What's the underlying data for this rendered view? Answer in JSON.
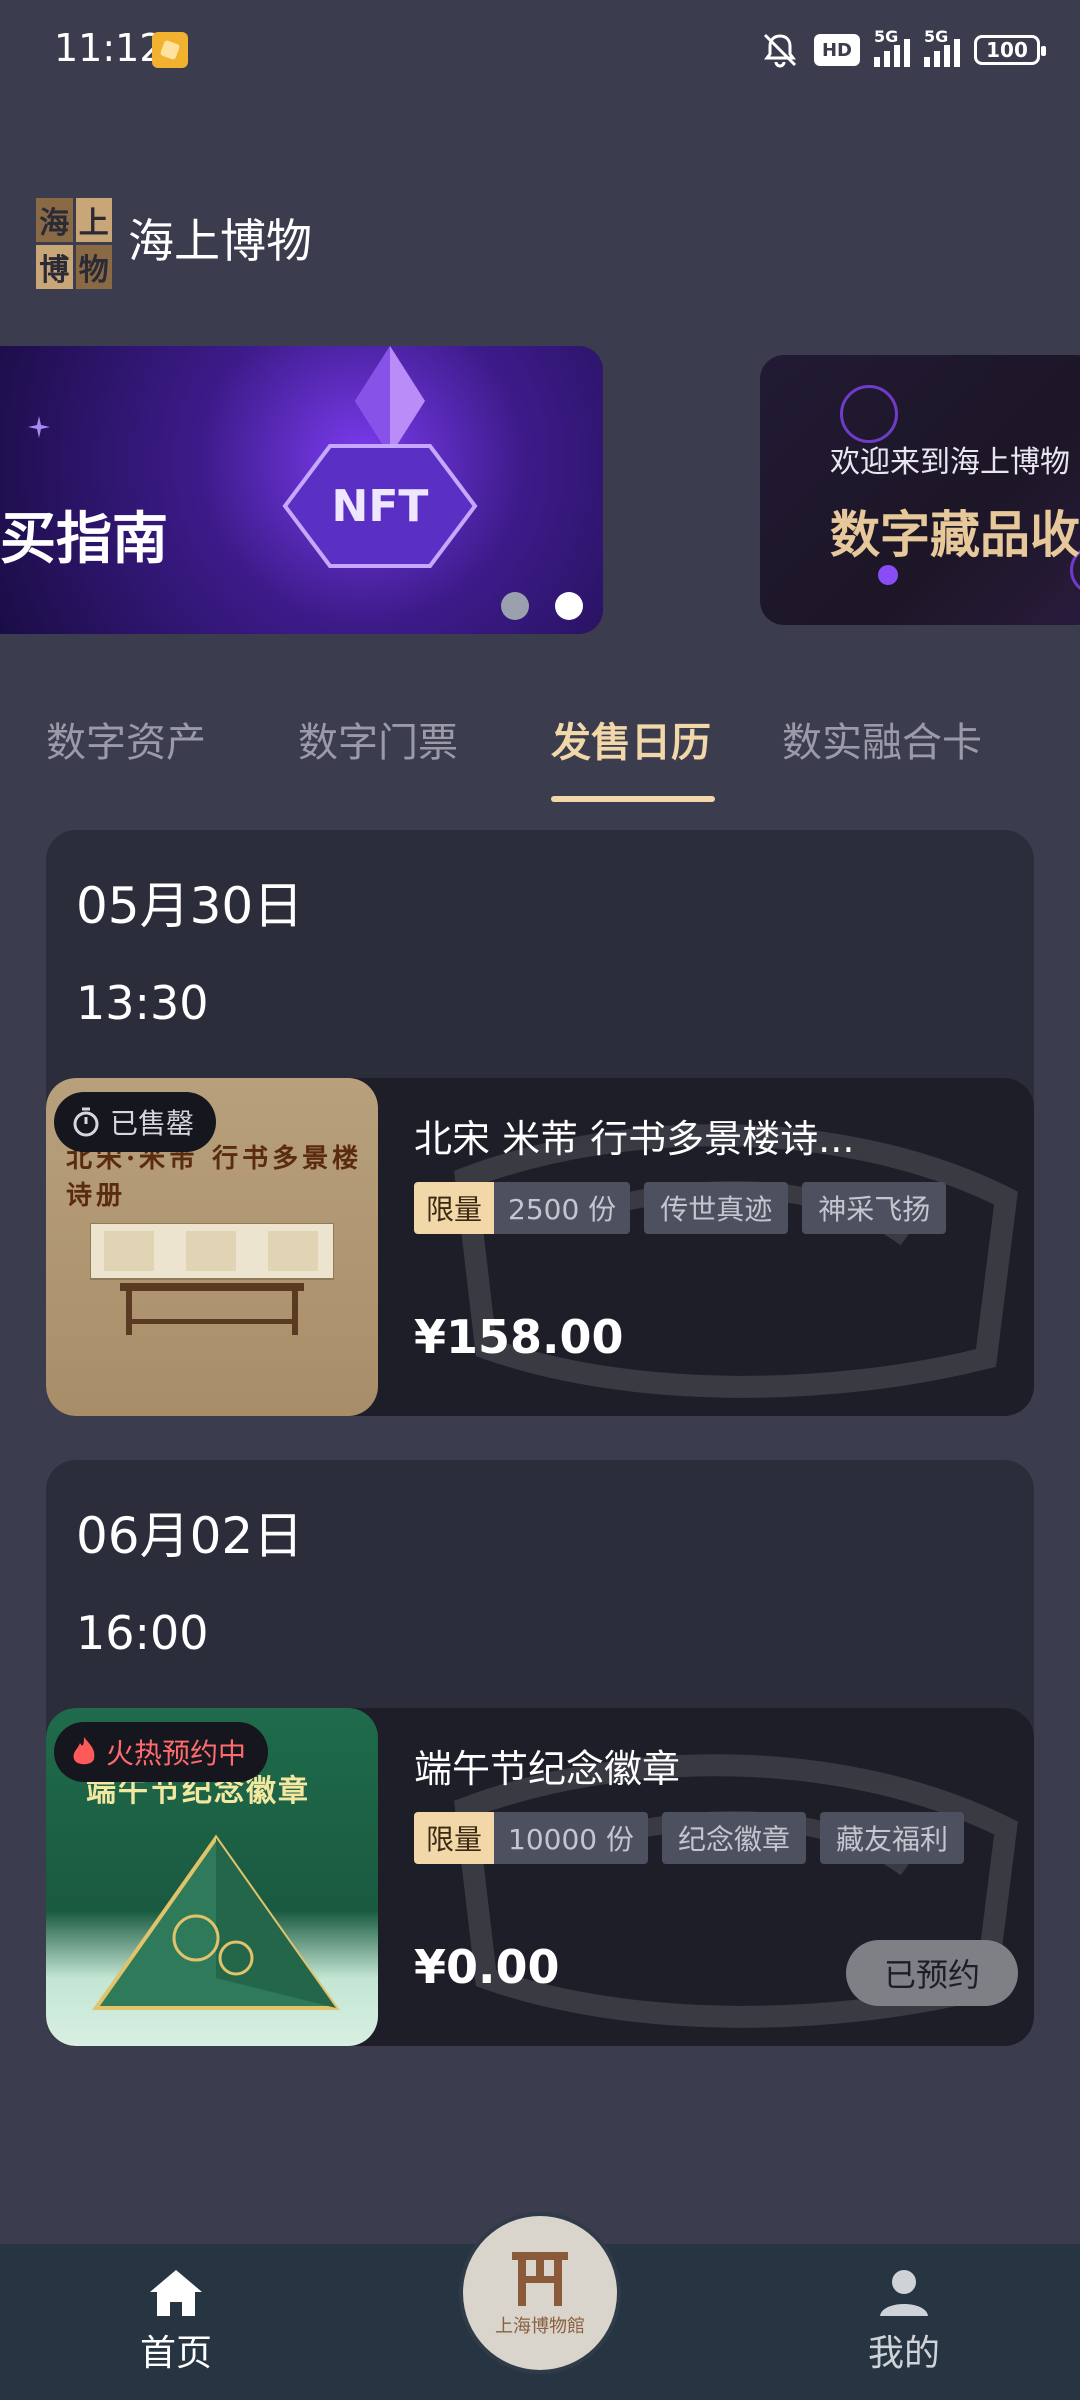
{
  "status_bar": {
    "time": "11:12",
    "hd": "HD",
    "signal1": "5G",
    "signal2": "5G",
    "battery": "100"
  },
  "header": {
    "logo_chars": [
      "海",
      "上",
      "博",
      "物"
    ],
    "title": "海上博物"
  },
  "banners": {
    "main_text": "买指南",
    "main_art": "NFT",
    "second_sub": "欢迎来到海上博物",
    "second_big": "数字藏品收"
  },
  "tabs": [
    {
      "label": "数字资产"
    },
    {
      "label": "数字门票"
    },
    {
      "label": "发售日历",
      "active": true
    },
    {
      "label": "数实融合卡"
    }
  ],
  "releases": [
    {
      "date": "05月30日",
      "time": "13:30",
      "badge": "已售罄",
      "image_caption": "北宋·米芾 行书多景楼诗册",
      "name": "北宋 米芾 行书多景楼诗...",
      "limit_label": "限量",
      "quantity": "2500 份",
      "tags": [
        "传世真迹",
        "神采飞扬"
      ],
      "price": "¥158.00"
    },
    {
      "date": "06月02日",
      "time": "16:00",
      "badge": "火热预约中",
      "image_caption": "端午节纪念徽章",
      "name": "端午节纪念徽章",
      "limit_label": "限量",
      "quantity": "10000 份",
      "tags": [
        "纪念徽章",
        "藏友福利"
      ],
      "price": "¥0.00",
      "button": "已预约"
    }
  ],
  "bottom_nav": {
    "home": "首页",
    "center_caption": "上海博物館",
    "mine": "我的"
  },
  "colors": {
    "background": "#3b3d4f",
    "accent_gold": "#f2d7a8",
    "card": "#2c2d3b",
    "hot_red": "#ff6b6b"
  }
}
